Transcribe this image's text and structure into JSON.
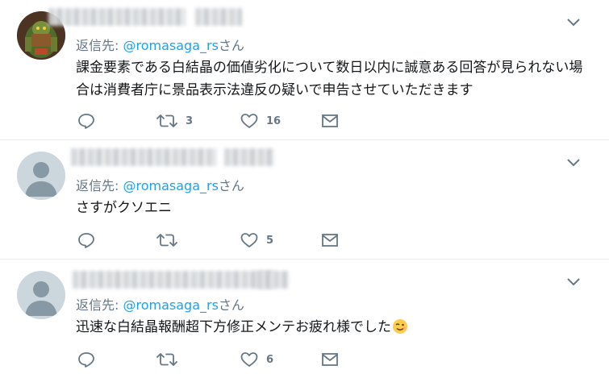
{
  "colors": {
    "link": "#1da1f2",
    "muted": "#657786",
    "text": "#14171a",
    "divider": "#e6ecf0",
    "icon": "#657786"
  },
  "tweets": [
    {
      "avatar": "character-figure-avatar",
      "reply_prefix": "返信先: ",
      "reply_handle": "@romasaga_rs",
      "reply_suffix": "さん",
      "text": "課金要素である白結晶の価値劣化について数日以内に誠意ある回答が見られない場合は消費者庁に景品表示法違反の疑いで申告させていただきます",
      "reply_count": "",
      "retweet_count": "3",
      "like_count": "16"
    },
    {
      "avatar": "default-avatar",
      "reply_prefix": "返信先: ",
      "reply_handle": "@romasaga_rs",
      "reply_suffix": "さん",
      "text": "さすがクソエニ",
      "reply_count": "",
      "retweet_count": "",
      "like_count": "5"
    },
    {
      "avatar": "default-avatar",
      "reply_prefix": "返信先: ",
      "reply_handle": "@romasaga_rs",
      "reply_suffix": "さん",
      "text": "迅速な白結晶報酬超下方修正メンテお疲れ様でした",
      "emoji": "😉",
      "reply_count": "",
      "retweet_count": "",
      "like_count": "6"
    }
  ],
  "icons": [
    "reply-icon",
    "retweet-icon",
    "like-icon",
    "direct-message-icon",
    "caret-down-icon"
  ]
}
